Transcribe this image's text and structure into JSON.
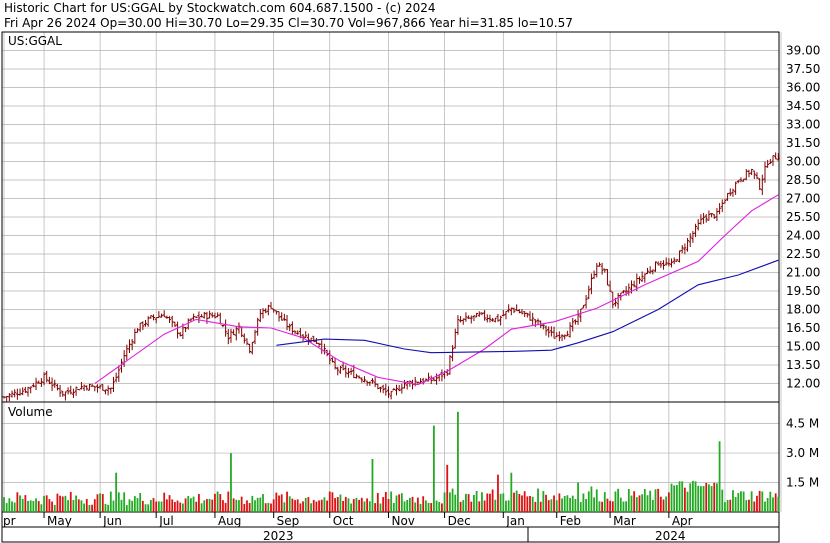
{
  "header": {
    "line1": "Historic Chart for US:GGAL by Stockwatch.com 604.687.1500 - (c) 2024",
    "line2": "Fri Apr 26 2024   Op=30.00   Hi=30.70   Lo=29.35   Cl=30.70   Vol=967,866   Year hi=31.85   lo=10.57"
  },
  "colors": {
    "background": "#ffffff",
    "grid": "#b0b0b0",
    "border": "#000000",
    "price_bar": "#800000",
    "sma_short": "#e020e0",
    "sma_long": "#1010b0",
    "volume_up": "#22aa22",
    "volume_down": "#dd1111"
  },
  "chart_data": [
    {
      "type": "ohlc",
      "panel": "price",
      "label": "US:GGAL",
      "y_ticks": [
        "39.00",
        "37.50",
        "36.00",
        "34.50",
        "33.00",
        "31.50",
        "30.00",
        "28.50",
        "27.00",
        "25.50",
        "24.00",
        "22.50",
        "21.00",
        "19.50",
        "18.00",
        "16.50",
        "15.00",
        "13.50",
        "12.00"
      ],
      "ylim": [
        10.5,
        40.5
      ],
      "price_path": [
        [
          0,
          10.9
        ],
        [
          8,
          11.5
        ],
        [
          15,
          12.5
        ],
        [
          22,
          11.2
        ],
        [
          30,
          11.8
        ],
        [
          40,
          11.6
        ],
        [
          42,
          12.5
        ],
        [
          45,
          14.3
        ],
        [
          50,
          16.5
        ],
        [
          55,
          17.3
        ],
        [
          60,
          17.6
        ],
        [
          66,
          16.0
        ],
        [
          70,
          17.2
        ],
        [
          75,
          17.5
        ],
        [
          80,
          17.5
        ],
        [
          84,
          15.8
        ],
        [
          88,
          16.6
        ],
        [
          92,
          14.8
        ],
        [
          96,
          17.7
        ],
        [
          100,
          18.3
        ],
        [
          103,
          17.4
        ],
        [
          107,
          16.5
        ],
        [
          112,
          15.9
        ],
        [
          118,
          15.3
        ],
        [
          124,
          13.2
        ],
        [
          130,
          12.8
        ],
        [
          137,
          12.2
        ],
        [
          142,
          11.4
        ],
        [
          145,
          11.1
        ],
        [
          150,
          12.0
        ],
        [
          155,
          12.2
        ],
        [
          161,
          12.3
        ],
        [
          166,
          13.0
        ],
        [
          170,
          17.0
        ],
        [
          178,
          17.5
        ],
        [
          185,
          17.2
        ],
        [
          190,
          18.1
        ],
        [
          195,
          17.6
        ],
        [
          200,
          16.9
        ],
        [
          206,
          15.8
        ],
        [
          211,
          16.2
        ],
        [
          215,
          17.3
        ],
        [
          218,
          19.0
        ],
        [
          222,
          21.7
        ],
        [
          225,
          21.0
        ],
        [
          228,
          18.5
        ],
        [
          233,
          19.5
        ],
        [
          238,
          20.5
        ],
        [
          245,
          21.8
        ],
        [
          250,
          21.6
        ],
        [
          256,
          23.5
        ],
        [
          262,
          25.5
        ],
        [
          267,
          25.7
        ],
        [
          270,
          27.0
        ],
        [
          275,
          28.5
        ],
        [
          280,
          29.3
        ],
        [
          283,
          28.0
        ],
        [
          286,
          30.0
        ],
        [
          290,
          30.5
        ]
      ],
      "sma_short": [
        [
          34,
          12.0
        ],
        [
          60,
          16.0
        ],
        [
          72,
          17.2
        ],
        [
          88,
          16.6
        ],
        [
          100,
          16.5
        ],
        [
          112,
          15.7
        ],
        [
          126,
          13.8
        ],
        [
          140,
          12.5
        ],
        [
          155,
          11.9
        ],
        [
          166,
          13.0
        ],
        [
          180,
          14.8
        ],
        [
          190,
          16.4
        ],
        [
          206,
          17.0
        ],
        [
          222,
          18.1
        ],
        [
          240,
          20.0
        ],
        [
          260,
          21.9
        ],
        [
          270,
          24.0
        ],
        [
          280,
          26.0
        ],
        [
          290,
          27.3
        ]
      ],
      "sma_long": [
        [
          102,
          15.1
        ],
        [
          120,
          15.6
        ],
        [
          135,
          15.5
        ],
        [
          150,
          14.8
        ],
        [
          160,
          14.5
        ],
        [
          190,
          14.6
        ],
        [
          205,
          14.7
        ],
        [
          215,
          15.3
        ],
        [
          228,
          16.2
        ],
        [
          245,
          18.0
        ],
        [
          260,
          20.0
        ],
        [
          275,
          20.8
        ],
        [
          290,
          22.0
        ]
      ],
      "x_month_labels": [
        "pr",
        "May",
        "Jun",
        "Jul",
        "Aug",
        "Sep",
        "Oct",
        "Nov",
        "Dec",
        "Jan",
        "Feb",
        "Mar",
        "Apr"
      ],
      "x_year_labels": [
        "2023",
        "2024"
      ]
    },
    {
      "type": "bar",
      "panel": "volume",
      "label": "Volume",
      "y_ticks": [
        "4.5 M",
        "3.0 M",
        "1.5 M"
      ],
      "ylim": [
        0,
        5.6
      ],
      "unit": "M",
      "spikes": [
        [
          42,
          2.0
        ],
        [
          85,
          3.0
        ],
        [
          138,
          2.7
        ],
        [
          161,
          4.4
        ],
        [
          166,
          2.4
        ],
        [
          170,
          5.1
        ],
        [
          185,
          1.9
        ],
        [
          190,
          2.0
        ],
        [
          215,
          1.5
        ],
        [
          220,
          1.3
        ],
        [
          268,
          3.6
        ]
      ]
    }
  ]
}
